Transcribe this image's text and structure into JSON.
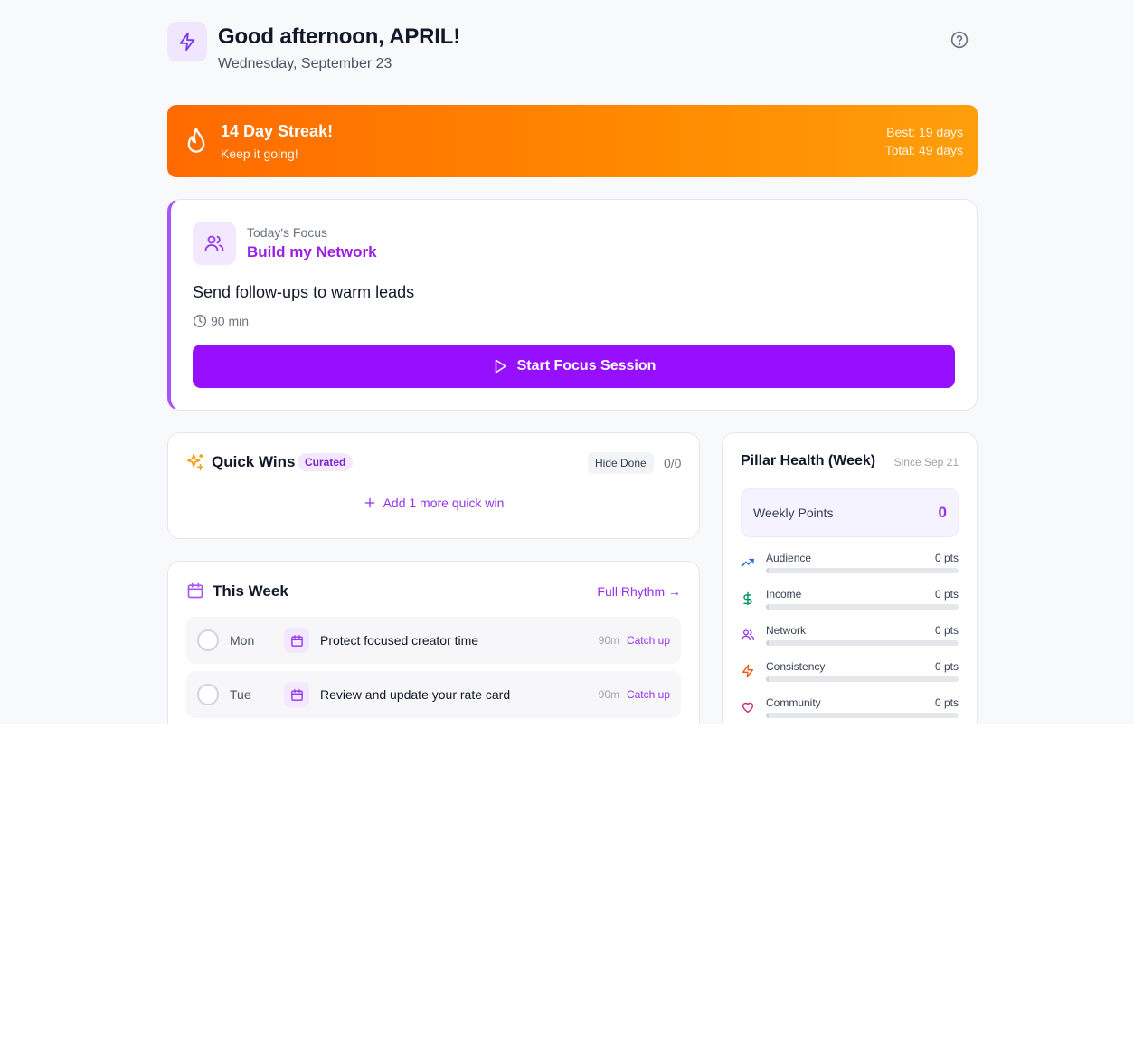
{
  "header": {
    "greeting": "Good afternoon, APRIL!",
    "date": "Wednesday, September 23"
  },
  "streak": {
    "title": "14 Day Streak!",
    "subtitle": "Keep it going!",
    "best": "Best: 19 days",
    "total": "Total: 49 days"
  },
  "focus": {
    "label": "Today's Focus",
    "pillar": "Build my Network",
    "task": "Send follow-ups to warm leads",
    "duration": "90 min",
    "start_label": "Start Focus Session"
  },
  "quick_wins": {
    "title": "Quick Wins",
    "badge": "Curated",
    "hide_done_label": "Hide Done",
    "count": "0/0",
    "add_label": "Add 1 more quick win"
  },
  "this_week": {
    "title": "This Week",
    "link_label": "Full Rhythm →",
    "rows": [
      {
        "day": "Mon",
        "task": "Protect focused creator time",
        "minutes": "90m",
        "action": "Catch up"
      },
      {
        "day": "Tue",
        "task": "Review and update your rate card",
        "minutes": "90m",
        "action": "Catch up"
      }
    ]
  },
  "pillar_health": {
    "title": "Pillar Health (Week)",
    "since": "Since Sep 21",
    "weekly_points_label": "Weekly Points",
    "weekly_points_value": "0",
    "pillars": [
      {
        "name": "Audience",
        "points": "0 pts",
        "icon": "trending-up-icon",
        "color": "#2563eb",
        "progress": 0
      },
      {
        "name": "Income",
        "points": "0 pts",
        "icon": "dollar-icon",
        "color": "#059669",
        "progress": 0
      },
      {
        "name": "Network",
        "points": "0 pts",
        "icon": "users-icon",
        "color": "#9333ea",
        "progress": 0
      },
      {
        "name": "Consistency",
        "points": "0 pts",
        "icon": "bolt-icon",
        "color": "#ea580c",
        "progress": 0
      },
      {
        "name": "Community",
        "points": "0 pts",
        "icon": "heart-icon",
        "color": "#db2777",
        "progress": 0
      }
    ]
  },
  "colors": {
    "accent": "#9610ff",
    "streak_start": "#ff6a00",
    "streak_end": "#ff9e0b"
  }
}
